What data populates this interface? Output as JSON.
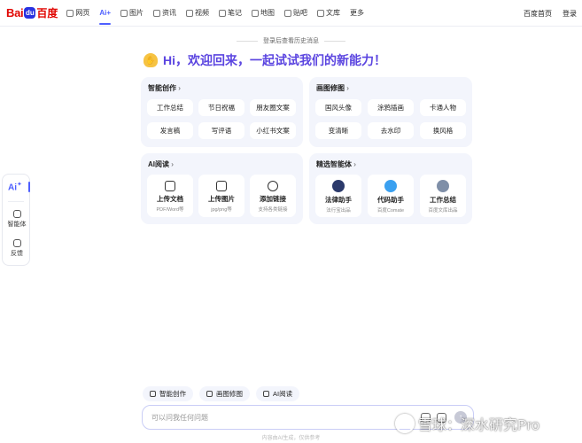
{
  "logo": {
    "text_latin": "Bai",
    "paw": "du",
    "text_cn": "百度"
  },
  "nav": [
    {
      "label": "网页",
      "icon": "search-icon"
    },
    {
      "label": "Ai+",
      "icon": "",
      "active": true
    },
    {
      "label": "图片",
      "icon": "image-icon"
    },
    {
      "label": "资讯",
      "icon": "news-icon"
    },
    {
      "label": "视频",
      "icon": "video-icon"
    },
    {
      "label": "笔记",
      "icon": "note-icon"
    },
    {
      "label": "地图",
      "icon": "map-icon"
    },
    {
      "label": "贴吧",
      "icon": "forum-icon"
    },
    {
      "label": "文库",
      "icon": "library-icon"
    },
    {
      "label": "更多",
      "icon": ""
    }
  ],
  "top_right": {
    "home": "百度首页",
    "login": "登录"
  },
  "rail": {
    "ai_label": "Ai",
    "agent": "智能体",
    "feedback": "反馈"
  },
  "history_hint": "登录后查看历史消息",
  "welcome": "Hi，欢迎回来，一起试试我们的新能力！",
  "cards": {
    "creation": {
      "title": "智能创作",
      "items": [
        "工作总结",
        "节日祝福",
        "朋友圈文案",
        "发言稿",
        "写评语",
        "小红书文案"
      ]
    },
    "image_edit": {
      "title": "画图修图",
      "items": [
        "国风头像",
        "涂鸦插画",
        "卡通人物",
        "变清晰",
        "去水印",
        "换风格"
      ]
    },
    "ai_reading": {
      "title": "AI阅读",
      "items": [
        {
          "name": "上传文档",
          "sub": "PDF/Word等",
          "icon": "folder-icon"
        },
        {
          "name": "上传图片",
          "sub": "jpg/png等",
          "icon": "picture-icon"
        },
        {
          "name": "添加链接",
          "sub": "支持各类链接",
          "icon": "globe-icon"
        }
      ]
    },
    "agents": {
      "title": "精选智能体",
      "items": [
        {
          "name": "法律助手",
          "sub": "法行宝出品",
          "color": "#2b3a6b"
        },
        {
          "name": "代码助手",
          "sub": "百度Comate",
          "color": "#3aa0f0"
        },
        {
          "name": "工作总结",
          "sub": "百度文库出品",
          "color": "#7f8fa8"
        }
      ]
    }
  },
  "chips": [
    "智能创作",
    "画图修图",
    "AI阅读"
  ],
  "chat": {
    "placeholder": "可以问我任何问题"
  },
  "disclaimer": "内容由AI生成，仅供参考",
  "watermark": "雪球：深水研究Pro"
}
